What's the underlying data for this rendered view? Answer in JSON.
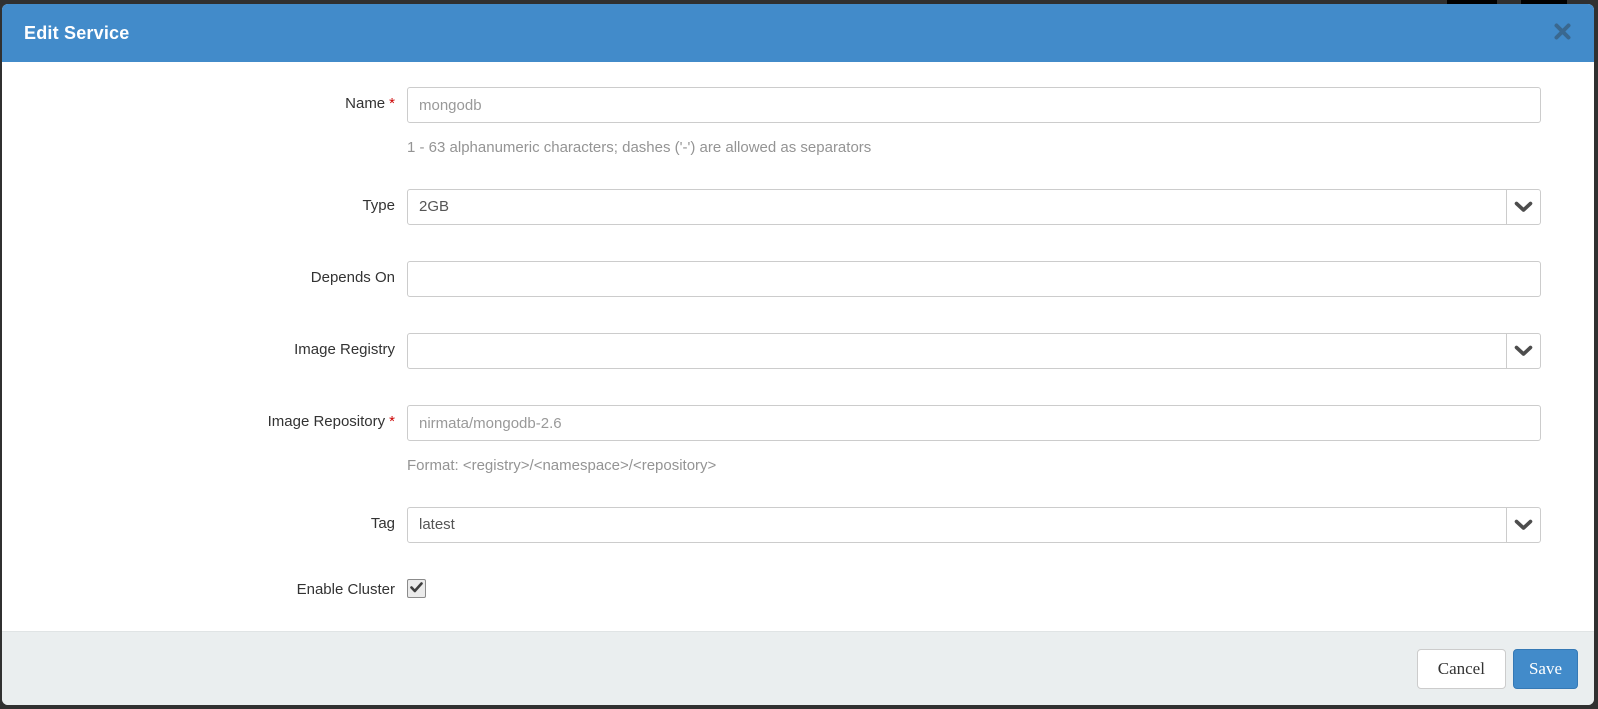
{
  "modal": {
    "title": "Edit Service",
    "icons": {
      "close": "x-close",
      "select_chevron": "chevron-down",
      "checkbox_check": "checkmark"
    }
  },
  "form": {
    "required_marker": "*",
    "name": {
      "label": "Name",
      "value": "mongodb",
      "help": "1 - 63 alphanumeric characters; dashes ('-') are allowed as separators"
    },
    "type": {
      "label": "Type",
      "value": "2GB"
    },
    "depends_on": {
      "label": "Depends On",
      "value": ""
    },
    "image_registry": {
      "label": "Image Registry",
      "value": ""
    },
    "image_repository": {
      "label": "Image Repository",
      "value": "nirmata/mongodb-2.6",
      "help": "Format: <registry>/<namespace>/<repository>"
    },
    "tag": {
      "label": "Tag",
      "value": "latest"
    },
    "enable_cluster": {
      "label": "Enable Cluster",
      "checked": true
    }
  },
  "footer": {
    "cancel_label": "Cancel",
    "save_label": "Save"
  },
  "colors": {
    "header_bg": "#428bca",
    "accent": "#428bca",
    "footer_bg": "#eaeeef",
    "required": "#cc0000",
    "placeholder_text": "#999999"
  }
}
